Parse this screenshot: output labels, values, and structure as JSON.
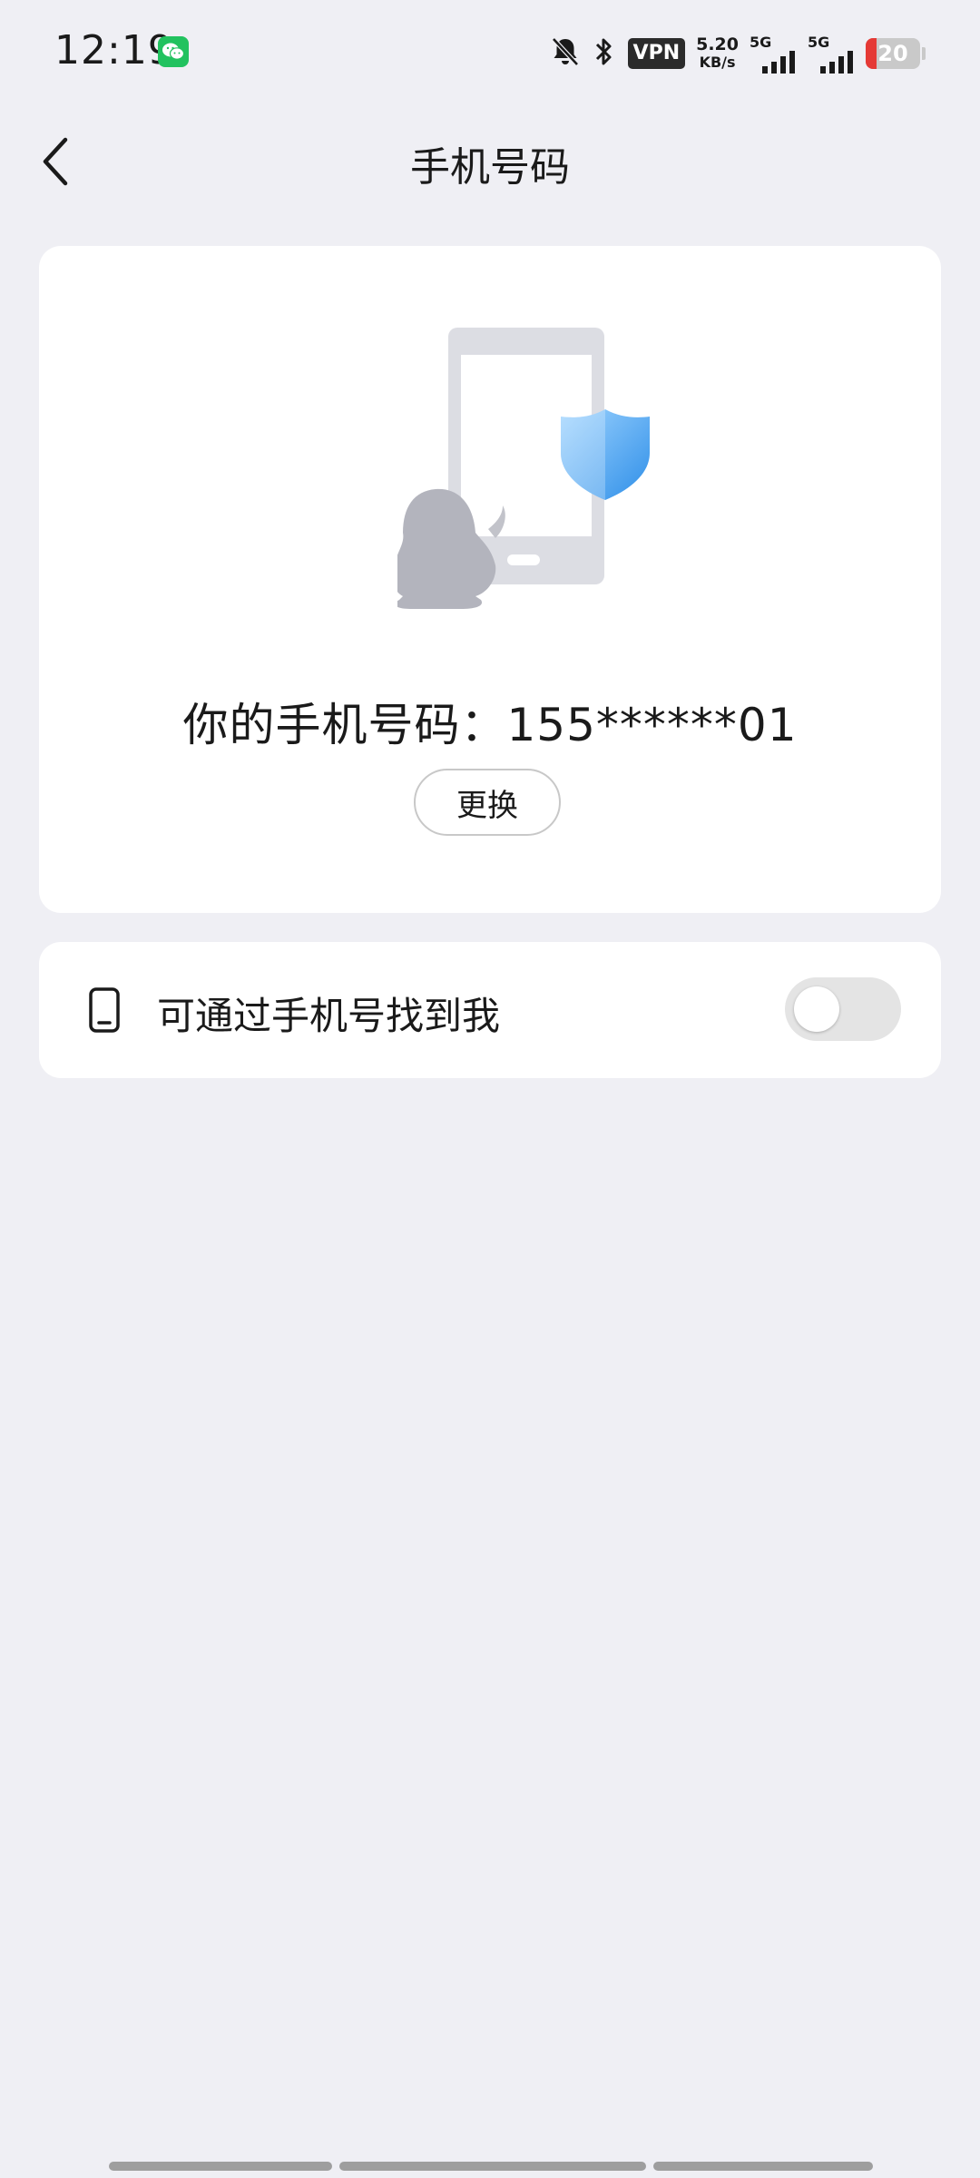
{
  "status_bar": {
    "time": "12:19",
    "notification_icon": "wechat-icon",
    "vpn_label": "VPN",
    "net_speed_value": "5.20",
    "net_speed_unit": "KB/s",
    "signal_1_label": "5G",
    "signal_2_label": "5G",
    "battery_level": "20",
    "battery_fraction": 0.2,
    "icons": [
      "bell-muted-icon",
      "bluetooth-icon"
    ]
  },
  "header": {
    "title": "手机号码",
    "back_icon": "chevron-left-icon"
  },
  "phone_card": {
    "illustration": "phone-shield-penguin-illustration",
    "phone_label": "你的手机号码：155******01",
    "change_button": "更换"
  },
  "find_me_setting": {
    "icon": "mobile-phone-icon",
    "label": "可通过手机号找到我",
    "enabled": false
  },
  "colors": {
    "background": "#efeff4",
    "card": "#ffffff",
    "toggle_off": "#e4e4e4",
    "shield_blue": "#3b9ef0",
    "battery_low": "#e53935"
  }
}
